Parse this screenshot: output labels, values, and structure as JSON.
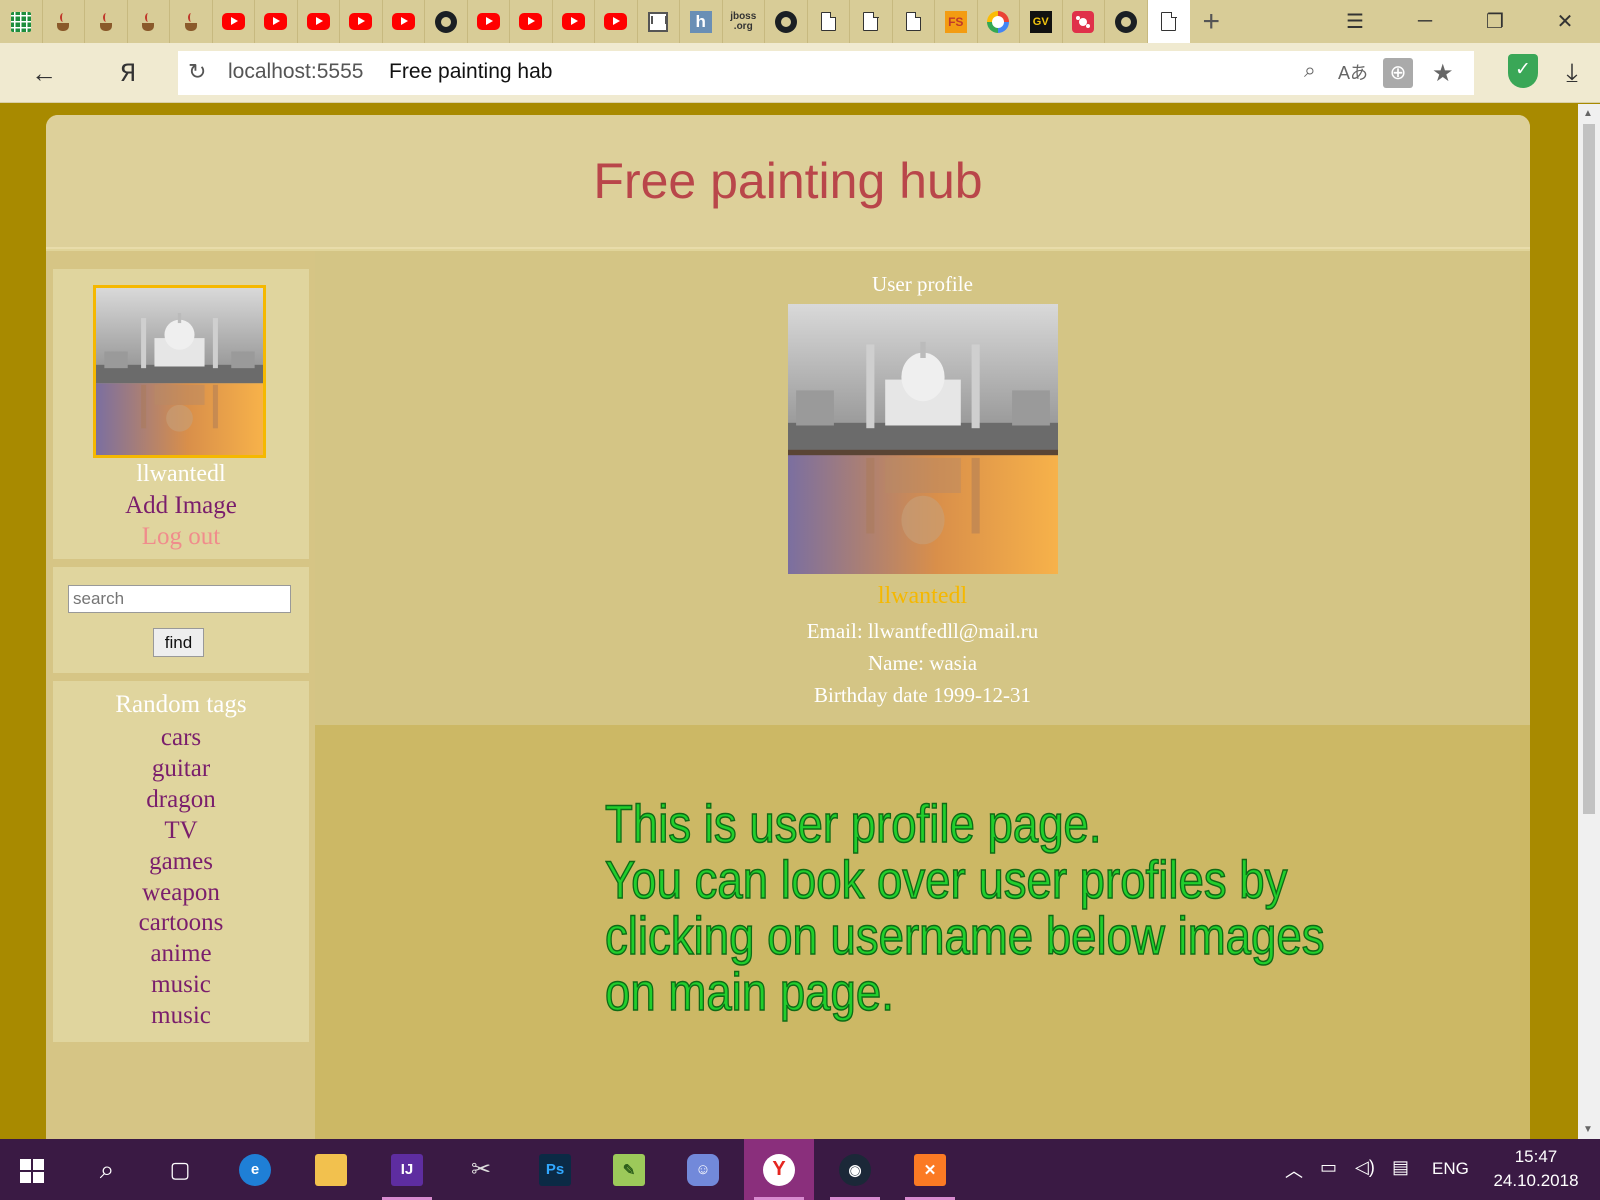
{
  "browser": {
    "tabs": [
      {
        "icon": "sheets-icon"
      },
      {
        "icon": "java-cup-icon"
      },
      {
        "icon": "java-cup-icon"
      },
      {
        "icon": "java-cup-icon"
      },
      {
        "icon": "java-cup-icon"
      },
      {
        "icon": "youtube-icon"
      },
      {
        "icon": "youtube-icon"
      },
      {
        "icon": "youtube-icon"
      },
      {
        "icon": "youtube-icon"
      },
      {
        "icon": "youtube-icon"
      },
      {
        "icon": "github-icon"
      },
      {
        "icon": "youtube-icon"
      },
      {
        "icon": "youtube-icon"
      },
      {
        "icon": "youtube-icon"
      },
      {
        "icon": "youtube-icon"
      },
      {
        "icon": "gmail-icon",
        "text": "M"
      },
      {
        "icon": "h-icon",
        "text": "h"
      },
      {
        "icon": "jboss-icon",
        "text": "jboss .org"
      },
      {
        "icon": "github-icon"
      },
      {
        "icon": "document-icon"
      },
      {
        "icon": "document-icon"
      },
      {
        "icon": "document-icon"
      },
      {
        "icon": "fs-icon",
        "text": "FS"
      },
      {
        "icon": "google-icon"
      },
      {
        "icon": "gv-icon",
        "text": "GV"
      },
      {
        "icon": "red-app-icon"
      },
      {
        "icon": "github-icon"
      },
      {
        "icon": "document-icon",
        "active": true
      }
    ],
    "new_tab_symbol": "+",
    "address": {
      "host": "localhost:5555",
      "title": "Free painting hab"
    },
    "yandex_button_label": "Я"
  },
  "page": {
    "site_title": "Free painting hub",
    "sidebar": {
      "username": "llwantedl",
      "add_image": "Add Image",
      "logout": "Log out",
      "search_placeholder": "search",
      "find_button": "find",
      "tags_title": "Random tags",
      "tags": [
        "cars",
        "guitar",
        "dragon",
        "TV",
        "games",
        "weapon",
        "cartoons",
        "anime",
        "music",
        "music"
      ]
    },
    "profile": {
      "heading": "User profile",
      "username": "llwantedl",
      "email": "Email: llwantfedll@mail.ru",
      "name": "Name: wasia",
      "birthday": "Birthday date 1999-12-31"
    },
    "note": {
      "lines": [
        "This is user profile page.",
        "You can look over user profiles by",
        "clicking on username below images",
        "on main page."
      ]
    }
  },
  "taskbar": {
    "apps": [
      "start-icon",
      "search-icon",
      "task-view-icon",
      "edge-icon",
      "file-explorer-icon",
      "intellij-icon",
      "snipping-tool-icon",
      "photoshop-icon",
      "notepad-plus-icon",
      "discord-icon",
      "yandex-browser-icon",
      "steam-icon",
      "xampp-icon"
    ],
    "language": "ENG",
    "time": "15:47",
    "date": "24.10.2018"
  },
  "colors": {
    "page_background": "#a88a00",
    "site_title": "#b9464a",
    "link_purple": "#7a1e6c",
    "logout_pink": "#f08c8c",
    "username_gold": "#f5b800",
    "note_green": "#21cf2c",
    "taskbar": "#3a1a44"
  }
}
